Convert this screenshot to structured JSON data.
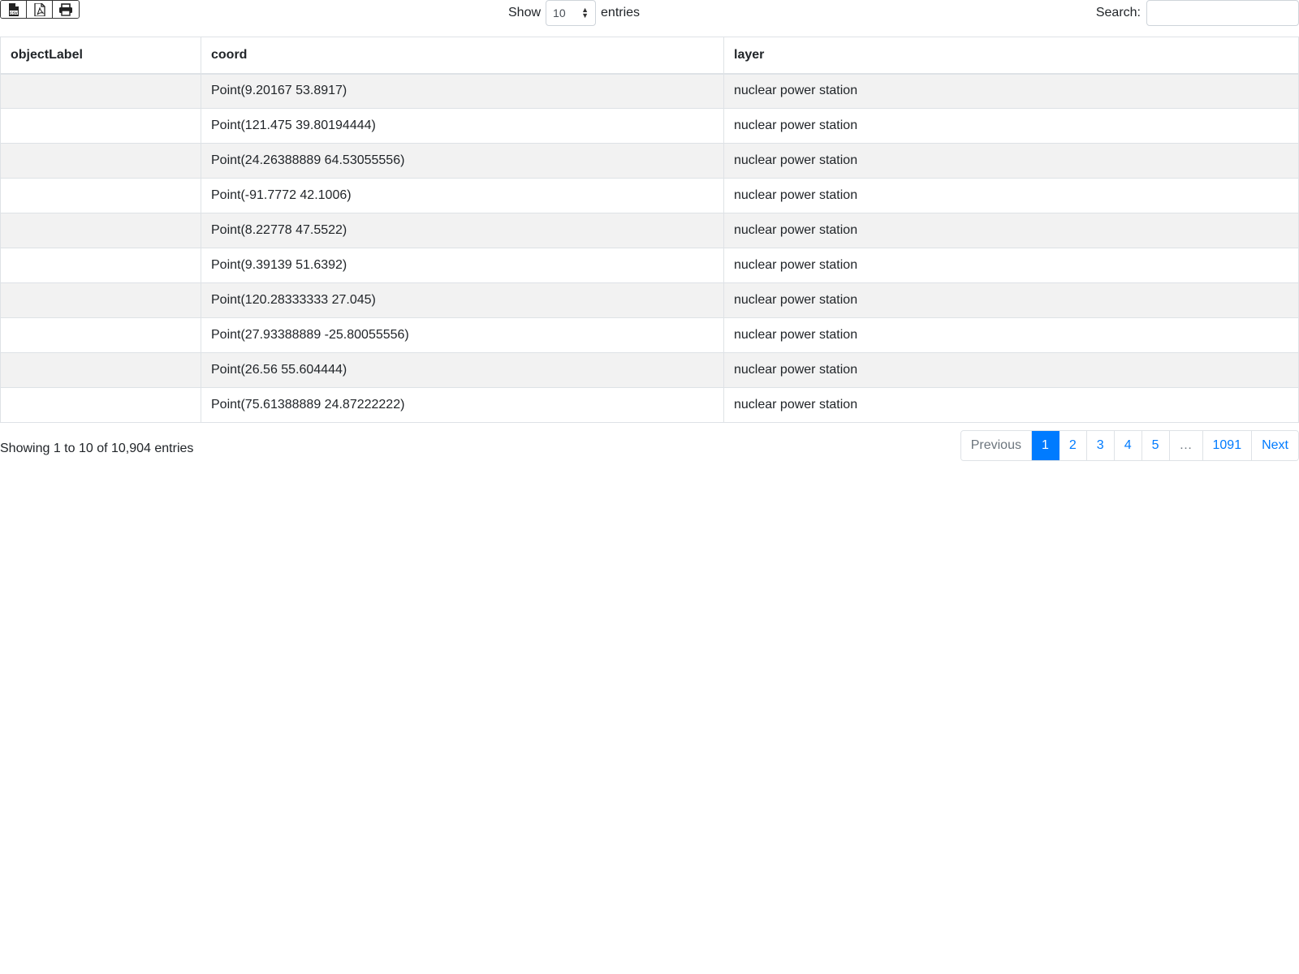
{
  "toolbar": {
    "export_buttons": [
      {
        "icon": "csv-file-icon"
      },
      {
        "icon": "pdf-file-icon"
      },
      {
        "icon": "print-icon"
      }
    ],
    "show_label": "Show",
    "entries_label": "entries",
    "page_length": "10",
    "search_label": "Search:",
    "search_value": ""
  },
  "table": {
    "columns": [
      "objectLabel",
      "coord",
      "layer"
    ],
    "rows": [
      {
        "objectLabel": "",
        "coord": "Point(9.20167 53.8917)",
        "layer": "nuclear power station"
      },
      {
        "objectLabel": "",
        "coord": "Point(121.475 39.80194444)",
        "layer": "nuclear power station"
      },
      {
        "objectLabel": "",
        "coord": "Point(24.26388889 64.53055556)",
        "layer": "nuclear power station"
      },
      {
        "objectLabel": "",
        "coord": "Point(-91.7772 42.1006)",
        "layer": "nuclear power station"
      },
      {
        "objectLabel": "",
        "coord": "Point(8.22778 47.5522)",
        "layer": "nuclear power station"
      },
      {
        "objectLabel": "",
        "coord": "Point(9.39139 51.6392)",
        "layer": "nuclear power station"
      },
      {
        "objectLabel": "",
        "coord": "Point(120.28333333 27.045)",
        "layer": "nuclear power station"
      },
      {
        "objectLabel": "",
        "coord": "Point(27.93388889 -25.80055556)",
        "layer": "nuclear power station"
      },
      {
        "objectLabel": "",
        "coord": "Point(26.56 55.604444)",
        "layer": "nuclear power station"
      },
      {
        "objectLabel": "",
        "coord": "Point(75.61388889 24.87222222)",
        "layer": "nuclear power station"
      }
    ]
  },
  "footer": {
    "info": "Showing 1 to 10 of 10,904 entries",
    "pagination": [
      {
        "label": "Previous",
        "state": "disabled"
      },
      {
        "label": "1",
        "state": "active"
      },
      {
        "label": "2",
        "state": ""
      },
      {
        "label": "3",
        "state": ""
      },
      {
        "label": "4",
        "state": ""
      },
      {
        "label": "5",
        "state": ""
      },
      {
        "label": "…",
        "state": "disabled"
      },
      {
        "label": "1091",
        "state": ""
      },
      {
        "label": "Next",
        "state": ""
      }
    ]
  },
  "colors": {
    "accent": "#007bff",
    "stripe": "#f2f2f2",
    "border": "#dee2e6"
  }
}
